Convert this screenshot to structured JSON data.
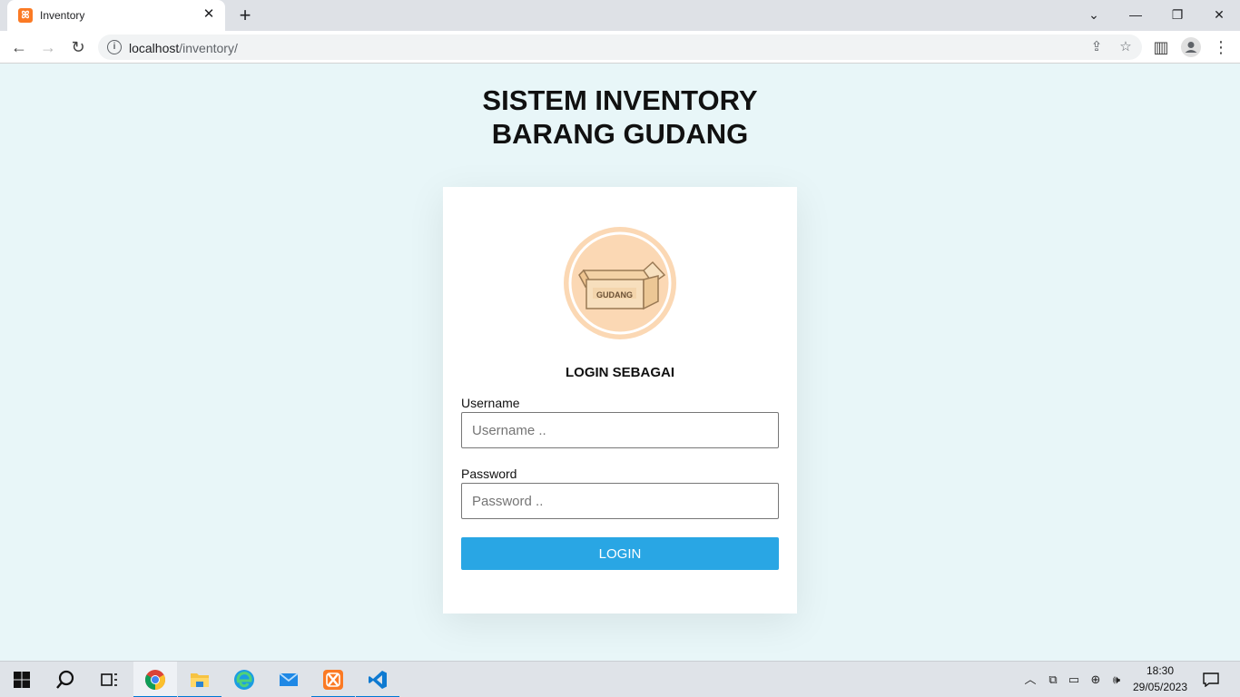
{
  "browser": {
    "tab_title": "Inventory",
    "tab_close": "✕",
    "new_tab": "+",
    "address_host": "localhost",
    "address_path": "/inventory/",
    "window_controls": {
      "minimize": "—",
      "restore": "❐",
      "close": "✕",
      "tab_search": "⌄"
    }
  },
  "page": {
    "title_line1": "SISTEM INVENTORY",
    "title_line2": "BARANG GUDANG",
    "logo_text": "GUDANG",
    "login_as": "LOGIN SEBAGAI",
    "username_label": "Username",
    "username_placeholder": "Username ..",
    "password_label": "Password",
    "password_placeholder": "Password ..",
    "login_button": "LOGIN"
  },
  "taskbar": {
    "time": "18:30",
    "date": "29/05/2023"
  },
  "colors": {
    "page_bg": "#e8f6f8",
    "button": "#29a6e4",
    "logo_circle": "#fbd8b4",
    "box": "#f5d9b0",
    "box_stroke": "#9a7a55"
  },
  "icons": [
    "xampp-icon",
    "back-icon",
    "forward-icon",
    "reload-icon",
    "info-icon",
    "share-icon",
    "star-icon",
    "sidepanel-icon",
    "profile-icon",
    "menu-icon",
    "windows-icon",
    "search-icon",
    "widgets-icon",
    "chrome-icon",
    "file-explorer-icon",
    "edge-icon",
    "mail-icon",
    "vscode-icon",
    "chevron-up-icon",
    "camera-icon",
    "battery-icon",
    "network-icon",
    "volume-icon",
    "notification-icon"
  ]
}
